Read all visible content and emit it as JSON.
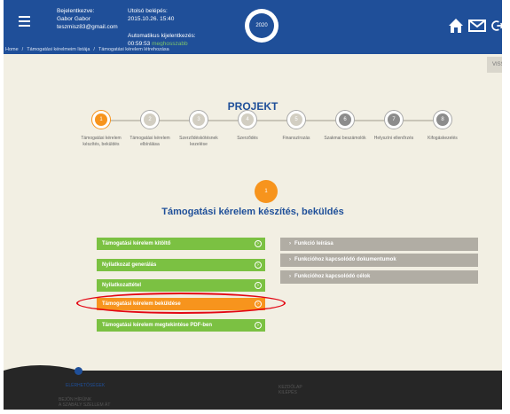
{
  "header": {
    "user_label": "Bejelentkezve:",
    "user_name": "Gabor Gabor",
    "user_email": "teszmisz83@gmail.com",
    "last_login_label": "Utolsó belépés:",
    "last_login_time": "2015.10.26. 15:40",
    "auto_logout_label": "Automatikus kijelentkezés:",
    "countdown": "00:59:53",
    "extend_label": "meghosszabb",
    "logo_text": "2020"
  },
  "breadcrumb": [
    "Home",
    "Támogatási kérelmeim listája",
    "Támogatási kérelem létrehozása"
  ],
  "back_label": "VISSZA",
  "page_title": "PROJEKT",
  "steps": [
    {
      "num": "1",
      "label": "Támogatási kérelem készítés, beküldés",
      "state": "active"
    },
    {
      "num": "2",
      "label": "Támogatási kérelem elbírálása",
      "state": "pending"
    },
    {
      "num": "3",
      "label": "Szerződéskötésnek kezelése",
      "state": "pending"
    },
    {
      "num": "4",
      "label": "Szerződés",
      "state": "pending"
    },
    {
      "num": "5",
      "label": "Finanszírozás",
      "state": "pending"
    },
    {
      "num": "6",
      "label": "Szakmai beszámolók",
      "state": "done"
    },
    {
      "num": "7",
      "label": "Helyszíni ellenőrzés",
      "state": "done"
    },
    {
      "num": "8",
      "label": "Kifogáskezelés",
      "state": "done"
    }
  ],
  "current_step": {
    "num": "1",
    "title": "Támogatási kérelem készítés, beküldés"
  },
  "actions": [
    {
      "label": "Támogatási kérelem kitöltő",
      "color": "green"
    },
    {
      "label": "Nyilatkozat generálás",
      "color": "green"
    },
    {
      "label": "Nyilatkozattétel",
      "color": "green"
    },
    {
      "label": "Támogatási kérelem beküldése",
      "color": "orange"
    },
    {
      "label": "Támogatási kérelem megtekintése PDF-ben",
      "color": "green"
    }
  ],
  "accordion": [
    {
      "label": "Funkció leírása"
    },
    {
      "label": "Funkcióhoz kapcsolódó dokumentumok"
    },
    {
      "label": "Funkcióhoz kapcsolódó célok"
    }
  ],
  "footer": {
    "left_title": "ELÉRHETŐSÉGEK",
    "left_line1": "BEJÖN HÍRÜNK",
    "left_line2": "A SZABÁLY SZELLEM ÁT",
    "mid_line1": "KEZDŐLAP",
    "mid_line2": "KILÉPÉS"
  },
  "colors": {
    "header_blue": "#1f4f99",
    "active_orange": "#f7941d",
    "action_green": "#7bc142",
    "highlight_red": "#e30613",
    "accordion_grey": "#b1ada4"
  }
}
